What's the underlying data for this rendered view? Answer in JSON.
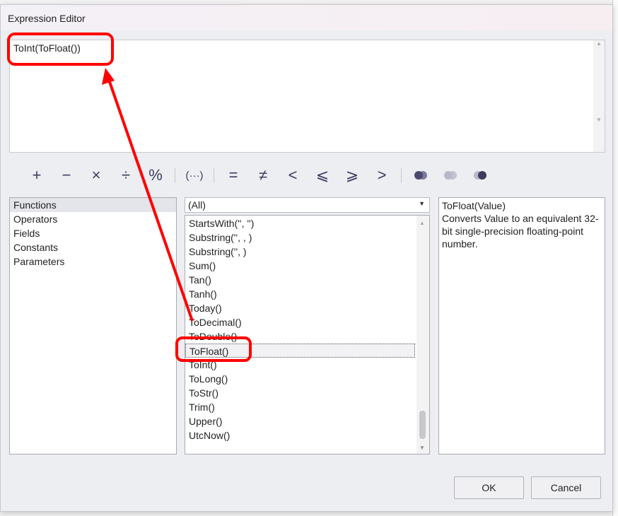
{
  "title": "Expression Editor",
  "expression": "ToInt(ToFloat())",
  "toolbar": {
    "operators": [
      "+",
      "−",
      "×",
      "÷",
      "%"
    ],
    "group": "(···)",
    "comparisons": [
      "=",
      "≠",
      "<",
      "⩽",
      "⩾",
      ">"
    ],
    "logic_icons": [
      "and-icon",
      "or-icon",
      "not-icon"
    ]
  },
  "categories": [
    "Functions",
    "Operators",
    "Fields",
    "Constants",
    "Parameters"
  ],
  "filter": "(All)",
  "functions": [
    "StartsWith('', '')",
    "Substring('', , )",
    "Substring('', )",
    "Sum()",
    "Tan()",
    "Tanh()",
    "Today()",
    "ToDecimal()",
    "ToDouble()",
    "ToFloat()",
    "ToInt()",
    "ToLong()",
    "ToStr()",
    "Trim()",
    "Upper()",
    "UtcNow()"
  ],
  "selected_function": "ToFloat()",
  "description": {
    "signature": "ToFloat(Value)",
    "text": "Converts Value to an equivalent 32-bit single-precision floating-point number."
  },
  "buttons": {
    "ok": "OK",
    "cancel": "Cancel"
  },
  "annotation_color": "#ff0000"
}
